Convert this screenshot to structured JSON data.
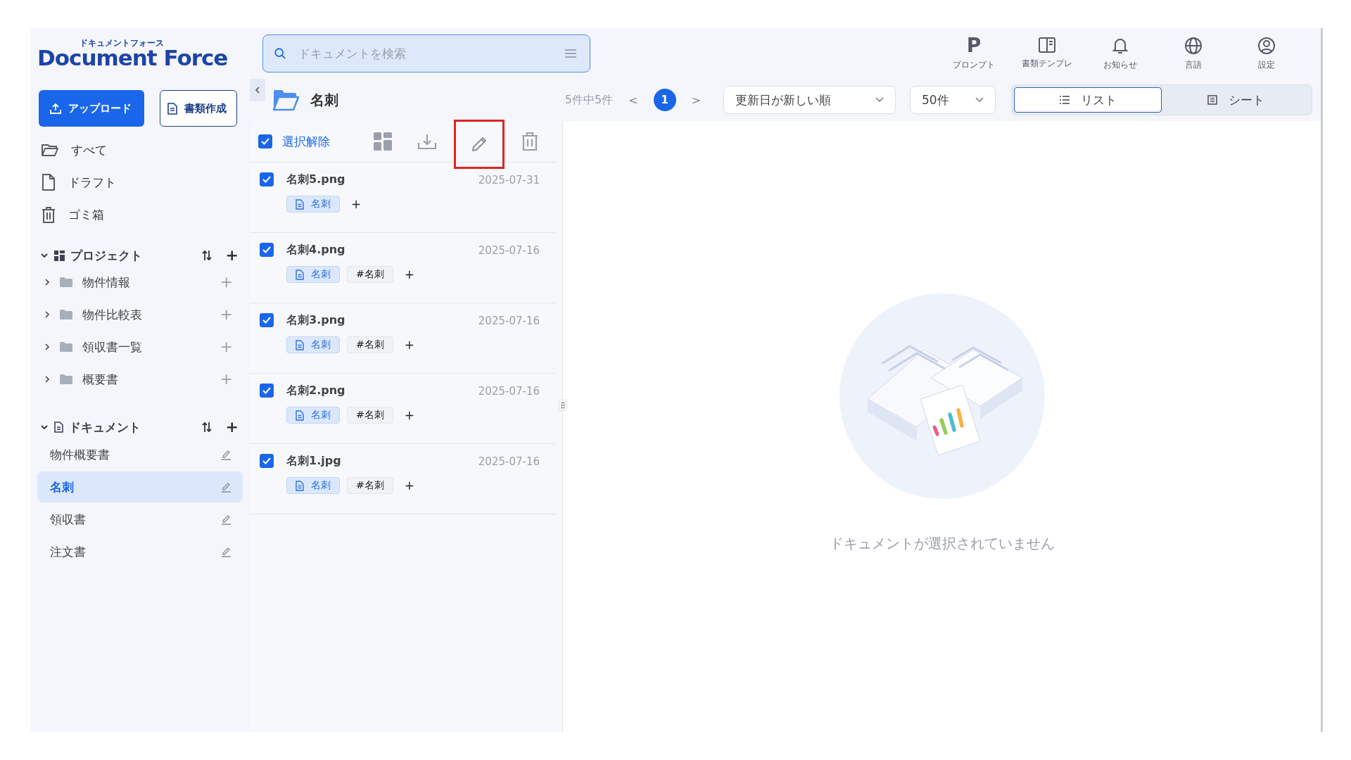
{
  "logo": {
    "kana": "ドキュメントフォース",
    "name": "Document Force"
  },
  "search": {
    "placeholder": "ドキュメントを検索"
  },
  "header_actions": [
    {
      "kind": "prompt",
      "glyph": "P",
      "label": "プロンプト"
    },
    {
      "kind": "template",
      "label": "書類テンプレ"
    },
    {
      "kind": "bell",
      "label": "お知らせ"
    },
    {
      "kind": "globe",
      "label": "言語"
    },
    {
      "kind": "user",
      "label": "設定"
    }
  ],
  "sidebar": {
    "buttons": [
      {
        "kind": "primary",
        "label": "アップロード"
      },
      {
        "kind": "outline",
        "label": "書類作成"
      }
    ],
    "nav": [
      {
        "kind": "folder",
        "label": "すべて"
      },
      {
        "kind": "file",
        "label": "ドラフト"
      },
      {
        "kind": "trash",
        "label": "ゴミ箱"
      }
    ],
    "projects": {
      "title": "プロジェクト",
      "expanded": true,
      "add": "+",
      "items": [
        {
          "label": "物件情報",
          "expanded": false,
          "add": "+"
        },
        {
          "label": "物件比較表",
          "expanded": false,
          "add": "+"
        },
        {
          "label": "領収書一覧",
          "expanded": false,
          "add": "+"
        },
        {
          "label": "概要書",
          "expanded": false,
          "add": "+"
        }
      ]
    },
    "documents": {
      "title": "ドキュメント",
      "expanded": true,
      "add": "+",
      "items": [
        {
          "label": "物件概要書",
          "selected": false
        },
        {
          "label": "名刺",
          "selected": true
        },
        {
          "label": "領収書",
          "selected": false
        },
        {
          "label": "注文書",
          "selected": false
        }
      ]
    }
  },
  "folder_title": "名刺",
  "pagination": {
    "count": "5件中5件",
    "prev": "<",
    "next": ">",
    "pages": [
      {
        "label": "1",
        "selected": true
      }
    ]
  },
  "sort": {
    "value": "更新日が新しい順"
  },
  "per_page": {
    "value": "50件"
  },
  "view_tabs": [
    {
      "kind": "list",
      "label": "リスト",
      "selected": true
    },
    {
      "kind": "sheet",
      "label": "シート",
      "selected": false
    }
  ],
  "toolbar": {
    "select_all": {
      "checked": true,
      "label": "選択解除"
    },
    "edit_highlighted": true
  },
  "files": [
    {
      "name": "名刺5.png",
      "date": "2025-07-31",
      "checked": true,
      "tags": [
        {
          "kind": "category",
          "label": "名刺"
        }
      ],
      "add": "+"
    },
    {
      "name": "名刺4.png",
      "date": "2025-07-16",
      "checked": true,
      "tags": [
        {
          "kind": "category",
          "label": "名刺"
        },
        {
          "kind": "hashtag",
          "label": "#名刺"
        }
      ],
      "add": "+"
    },
    {
      "name": "名刺3.png",
      "date": "2025-07-16",
      "checked": true,
      "tags": [
        {
          "kind": "category",
          "label": "名刺"
        },
        {
          "kind": "hashtag",
          "label": "#名刺"
        }
      ],
      "add": "+"
    },
    {
      "name": "名刺2.png",
      "date": "2025-07-16",
      "checked": true,
      "tags": [
        {
          "kind": "category",
          "label": "名刺"
        },
        {
          "kind": "hashtag",
          "label": "#名刺"
        }
      ],
      "add": "+"
    },
    {
      "name": "名刺1.jpg",
      "date": "2025-07-16",
      "checked": true,
      "tags": [
        {
          "kind": "category",
          "label": "名刺"
        },
        {
          "kind": "hashtag",
          "label": "#名刺"
        }
      ],
      "add": "+"
    }
  ],
  "empty_message": "ドキュメントが選択されていません"
}
